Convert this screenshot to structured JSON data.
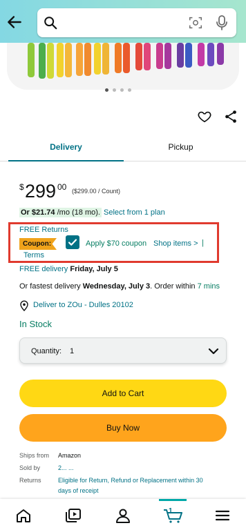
{
  "search": {
    "placeholder": "",
    "value": ""
  },
  "icons": [
    "back-arrow-icon",
    "search-icon",
    "camera-icon",
    "microphone-icon",
    "heart-icon",
    "share-icon",
    "location-pin-icon",
    "chevron-down-icon",
    "home-icon",
    "video-icon",
    "account-icon",
    "cart-icon",
    "menu-icon"
  ],
  "tabs": {
    "delivery": "Delivery",
    "pickup": "Pickup"
  },
  "price": {
    "currency": "$",
    "whole": "299",
    "fraction": "00",
    "unit_price": "($299.00 / Count)"
  },
  "plan": {
    "amount": "Or $21.74",
    "term": "/mo (18 mo).",
    "link": "Select from 1 plan"
  },
  "coupon": {
    "free_returns": "FREE Returns",
    "badge": "Coupon:",
    "apply": "Apply $70 coupon",
    "shop_items": "Shop items >",
    "separator": "|",
    "terms": "Terms"
  },
  "delivery": {
    "free_label": "FREE delivery",
    "free_date": "Friday, July 5",
    "fastest_prefix": "Or fastest delivery",
    "fastest_date": "Wednesday, July 3",
    "order_within": ". Order within",
    "time_left": "7 mins",
    "deliver_to": "Deliver to ZOu - Dulles 20102"
  },
  "stock": "In Stock",
  "quantity": {
    "label": "Quantity:",
    "value": "1"
  },
  "buttons": {
    "add_to_cart": "Add to Cart",
    "buy_now": "Buy Now"
  },
  "details": {
    "ships_from_label": "Ships from",
    "ships_from": "Amazon",
    "sold_by_label": "Sold by",
    "sold_by": "2... ...",
    "returns_label": "Returns",
    "returns_line1": "Eligible for Return, Refund or Replacement within 30",
    "returns_line2": "days of receipt"
  },
  "cart_count": "1",
  "colors": {
    "teal": "#007185",
    "green": "#067d62",
    "yellow": "#ffd814",
    "orange": "#ffa41c",
    "red_box": "#e03a2e"
  }
}
